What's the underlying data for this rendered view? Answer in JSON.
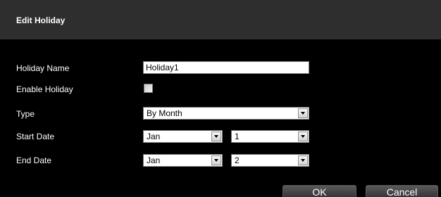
{
  "dialog": {
    "title": "Edit Holiday"
  },
  "form": {
    "holiday_name_label": "Holiday Name",
    "holiday_name_value": "Holiday1",
    "enable_holiday_label": "Enable Holiday",
    "enable_holiday_checked": false,
    "type_label": "Type",
    "type_value": "By Month",
    "start_date_label": "Start Date",
    "start_month": "Jan",
    "start_day": "1",
    "end_date_label": "End Date",
    "end_month": "Jan",
    "end_day": "2"
  },
  "buttons": {
    "ok_label": "OK",
    "cancel_label": "Cancel"
  },
  "colors": {
    "background": "#000000",
    "title_bar": "#2e2e2e",
    "text": "#ffffff"
  }
}
